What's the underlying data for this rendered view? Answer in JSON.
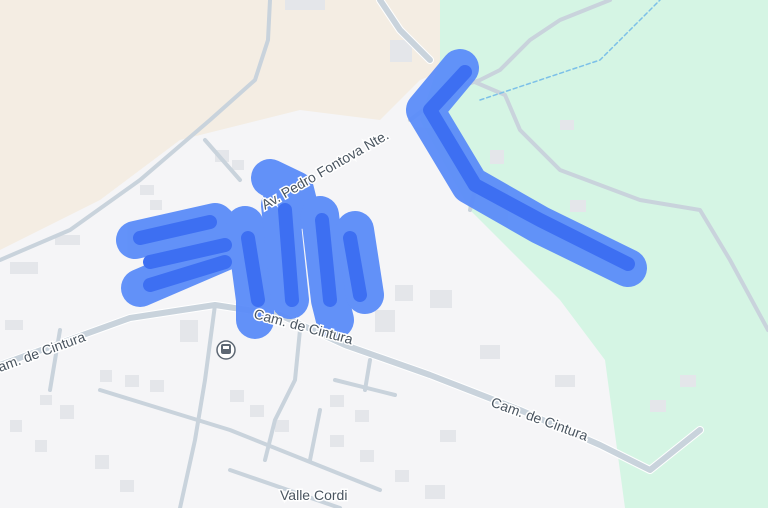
{
  "map": {
    "colors": {
      "land": "#f5f5f7",
      "sand": "#f4ede3",
      "park": "#d5f5e4",
      "road": "#c9d3dc",
      "road_casing": "#ffffff",
      "building": "#e4e6ea",
      "route": "#4a7cf7",
      "route_halo": "#5b8cf9",
      "label": "#4a5560"
    },
    "labels": {
      "av_pedro": "Av. Pedro Fontova Nte.",
      "cintura_left": "am. de Cintura",
      "cintura_center": "Cam. de Cintura",
      "cintura_right": "Cam. de Cintura",
      "valle": "Valle Cordi"
    },
    "icons": {
      "transit": "bus-stop-icon"
    }
  }
}
